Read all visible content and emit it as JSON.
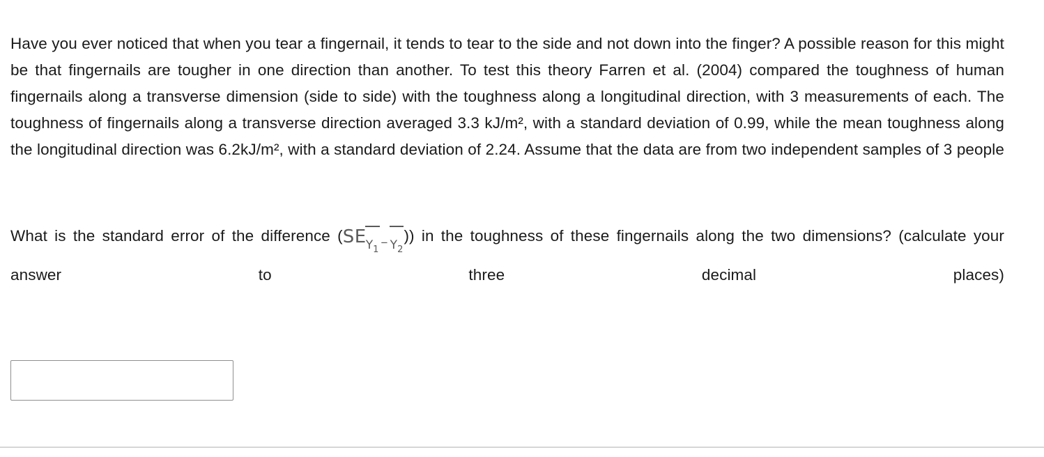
{
  "document": {
    "background_color": "#ffffff",
    "text_color": "#1a1a1a",
    "math_color": "#5a5a5a",
    "divider_color": "#d6d6d6",
    "input_border_color": "#8e8e8e"
  },
  "question": {
    "stem": "Have you ever noticed that when you tear a fingernail, it tends to tear to the side and not down into the finger? A possible reason for this might be that fingernails are tougher in one direction than another. To test this theory Farren et al. (2004) compared the toughness of human fingernails along a transverse dimension (side to side) with the toughness along a longitudinal direction, with 3 measurements of each. The toughness of fingernails along a transverse direction averaged 3.3 kJ/m², with a standard deviation of 0.99, while the mean toughness along the longitudinal direction was 6.2kJ/m², with a standard deviation of 2.24. Assume that the data are from two independent samples of 3 people",
    "prompt_before_math": "What is the standard error of the difference (",
    "prompt_after_math": ") in the toughness of these fingernails along the two dimensions?",
    "instruction": "(calculate your answer to three decimal places)",
    "math": {
      "symbol": "SE",
      "open_paren": "(",
      "close_paren": ")",
      "operator": "−",
      "term_1_variable": "Y",
      "term_1_index": "1",
      "term_2_variable": "Y",
      "term_2_index": "2"
    },
    "values": {
      "transverse_mean": "3.3 kJ/m²",
      "transverse_sd": "0.99",
      "longitudinal_mean": "6.2kJ/m²",
      "longitudinal_sd": "2.24",
      "sample_size": "3",
      "measurements_each": "3",
      "study_citation": "Farren et al. (2004)"
    }
  },
  "answer": {
    "value": "",
    "placeholder": ""
  }
}
